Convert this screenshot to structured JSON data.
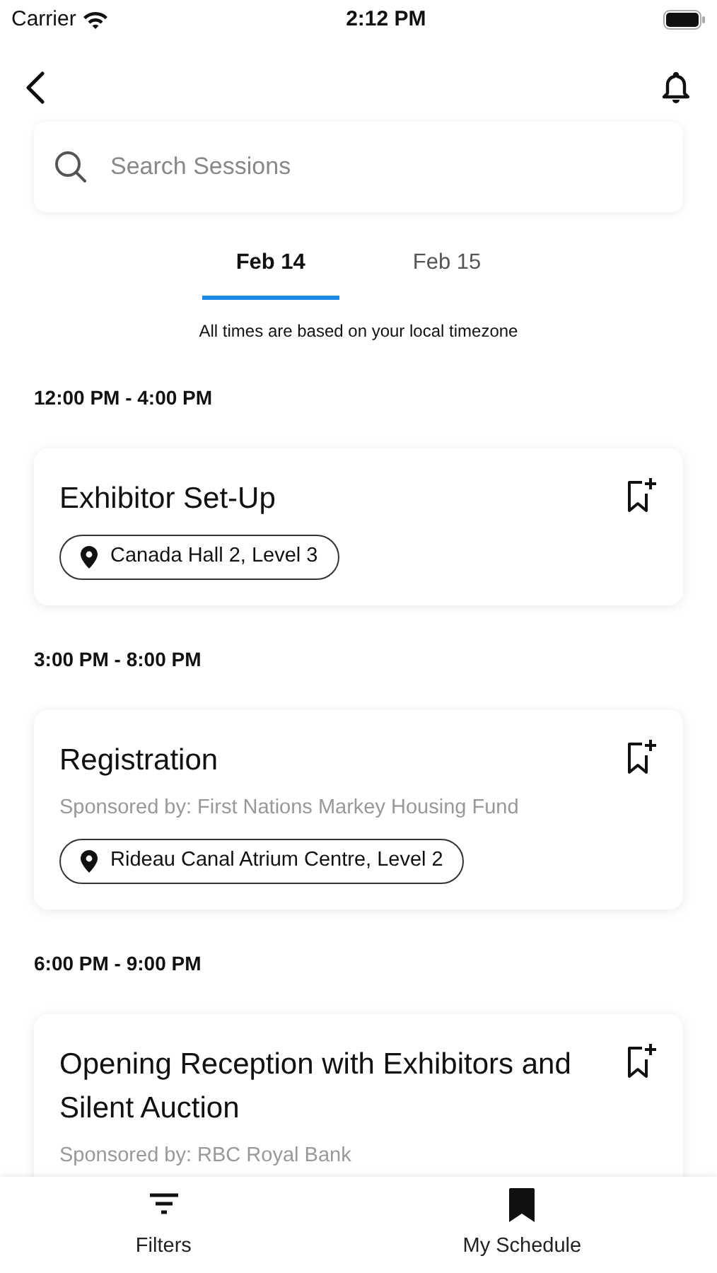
{
  "status_bar": {
    "carrier": "Carrier",
    "time": "2:12 PM"
  },
  "search": {
    "placeholder": "Search Sessions"
  },
  "tabs": [
    {
      "label": "Feb 14",
      "selected": true
    },
    {
      "label": "Feb 15",
      "selected": false
    }
  ],
  "timezone_note": "All times are based on your local timezone",
  "groups": [
    {
      "time": "12:00 PM - 4:00 PM",
      "sessions": [
        {
          "title": "Exhibitor Set-Up",
          "location": "Canada Hall 2, Level 3",
          "bookmarked": false
        }
      ]
    },
    {
      "time": "3:00 PM - 8:00 PM",
      "sessions": [
        {
          "title": "Registration",
          "sponsor": "Sponsored by: First Nations Markey Housing Fund",
          "location": "Rideau Canal Atrium Centre, Level 2",
          "bookmarked": false
        }
      ]
    },
    {
      "time": "6:00 PM - 9:00 PM",
      "sessions": [
        {
          "title": "Opening Reception with Exhibitors and Silent Auction",
          "sponsor": "Sponsored by: RBC Royal Bank",
          "bookmarked": false
        }
      ]
    }
  ],
  "bottom_nav": [
    {
      "kind": "filters",
      "label": "Filters"
    },
    {
      "kind": "schedule",
      "label": "My Schedule"
    }
  ]
}
